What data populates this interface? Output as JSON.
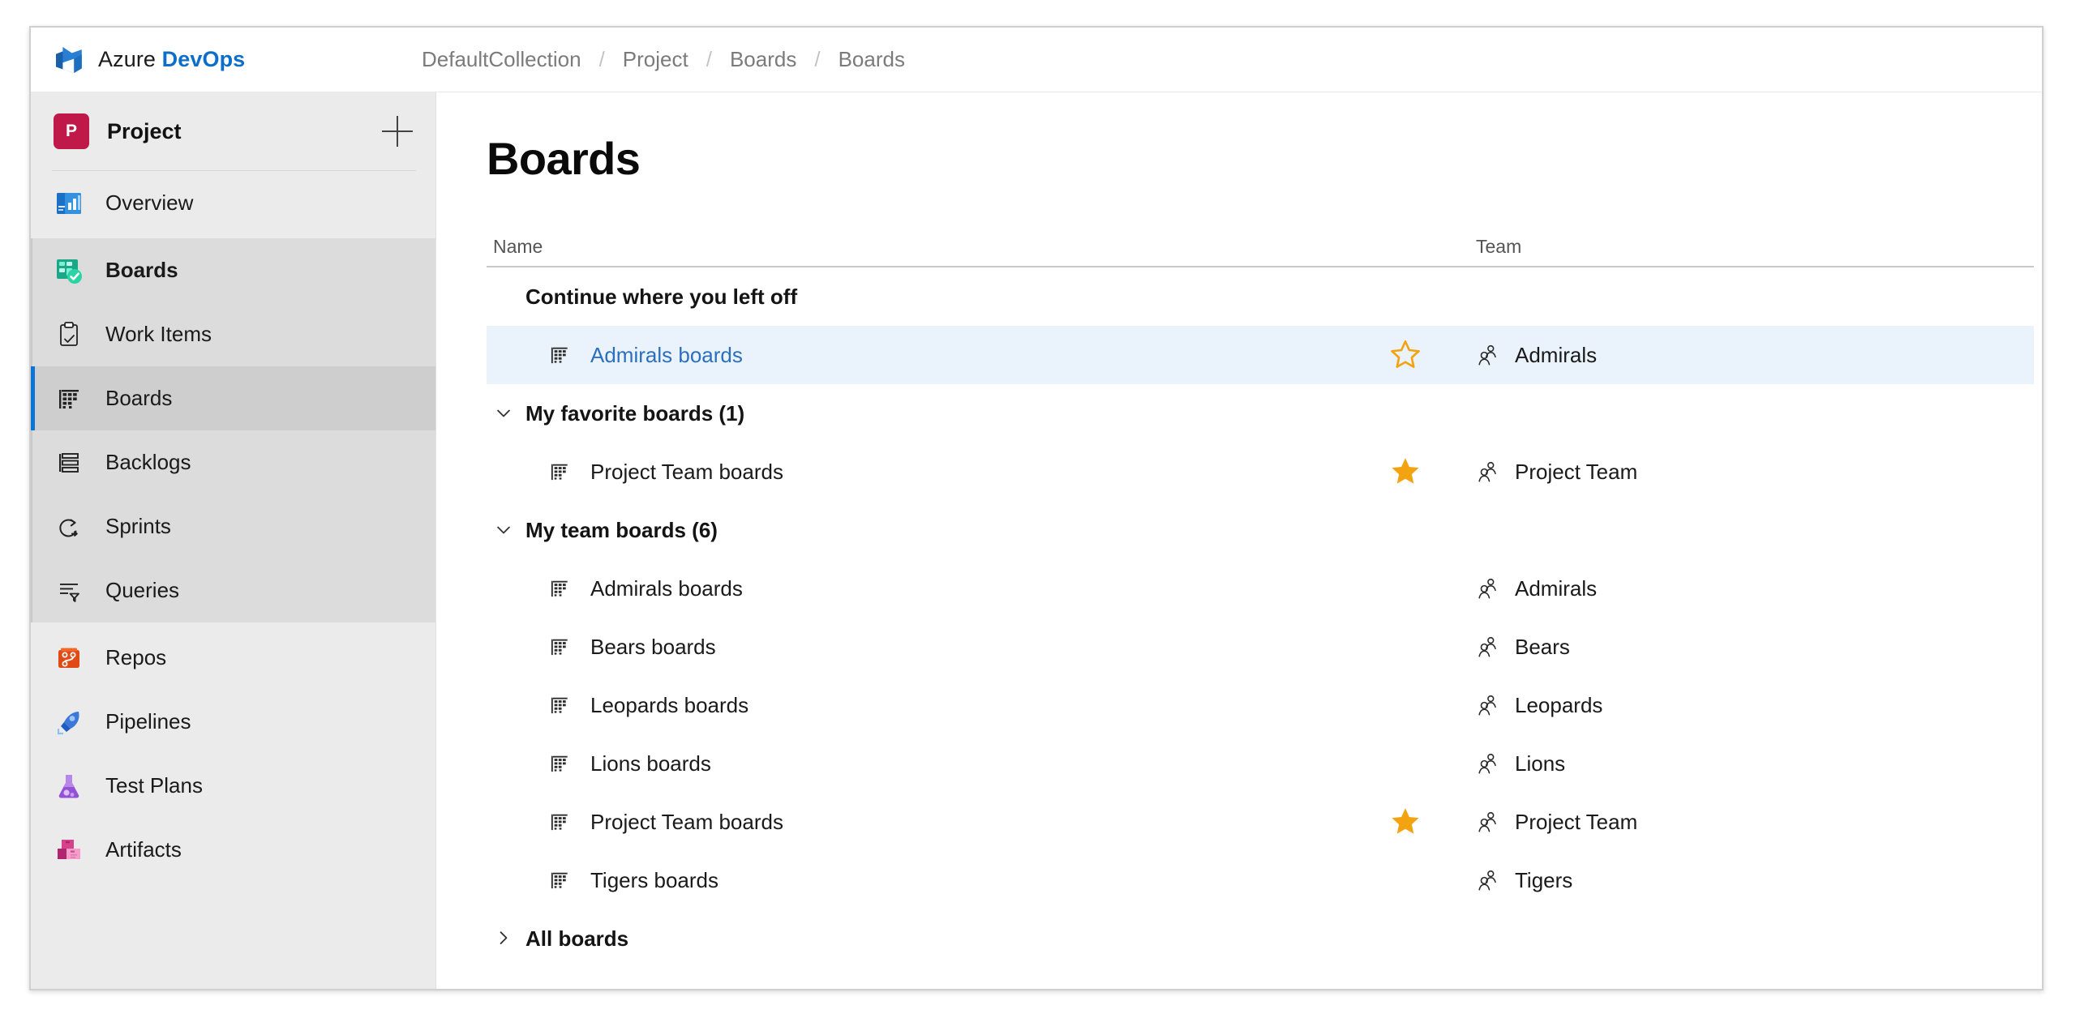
{
  "topbar": {
    "logo_icon": "azure-devops-logo",
    "brand_prefix": "Azure ",
    "brand_suffix": "DevOps",
    "breadcrumb": [
      "DefaultCollection",
      "Project",
      "Boards",
      "Boards"
    ],
    "breadcrumb_separator": "/"
  },
  "sidebar": {
    "project": {
      "avatar_letter": "P",
      "name": "Project",
      "avatar_color": "#bf1849",
      "add_icon": "plus-icon"
    },
    "top_items": [
      {
        "label": "Overview",
        "icon": "overview-icon"
      }
    ],
    "boards_group": [
      {
        "label": "Boards",
        "icon": "boards-product-icon",
        "bold": true,
        "selected": false
      },
      {
        "label": "Work Items",
        "icon": "work-items-icon",
        "bold": false,
        "selected": false
      },
      {
        "label": "Boards",
        "icon": "board-grid-icon",
        "bold": false,
        "selected": true
      },
      {
        "label": "Backlogs",
        "icon": "backlogs-icon",
        "bold": false,
        "selected": false
      },
      {
        "label": "Sprints",
        "icon": "sprints-icon",
        "bold": false,
        "selected": false
      },
      {
        "label": "Queries",
        "icon": "queries-icon",
        "bold": false,
        "selected": false
      }
    ],
    "tail_items": [
      {
        "label": "Repos",
        "icon": "repos-icon"
      },
      {
        "label": "Pipelines",
        "icon": "pipelines-icon"
      },
      {
        "label": "Test Plans",
        "icon": "test-plans-icon"
      },
      {
        "label": "Artifacts",
        "icon": "artifacts-icon"
      }
    ]
  },
  "main": {
    "title": "Boards",
    "columns": {
      "name": "Name",
      "team": "Team"
    },
    "sections": [
      {
        "title": "Continue where you left off",
        "expander": "none",
        "rows": [
          {
            "name": "Admirals boards",
            "team": "Admirals",
            "star": "outline",
            "highlight": true,
            "link": true,
            "board_icon": "board-grid-icon",
            "team_icon": "team-group-icon"
          }
        ]
      },
      {
        "title": "My favorite boards (1)",
        "expander": "chevron-down-icon",
        "rows": [
          {
            "name": "Project Team boards",
            "team": "Project Team",
            "star": "filled",
            "highlight": false,
            "link": false,
            "board_icon": "board-grid-icon",
            "team_icon": "team-group-icon"
          }
        ]
      },
      {
        "title": "My team boards (6)",
        "expander": "chevron-down-icon",
        "rows": [
          {
            "name": "Admirals boards",
            "team": "Admirals",
            "star": "none",
            "highlight": false,
            "link": false,
            "board_icon": "board-grid-icon",
            "team_icon": "team-group-icon"
          },
          {
            "name": "Bears boards",
            "team": "Bears",
            "star": "none",
            "highlight": false,
            "link": false,
            "board_icon": "board-grid-icon",
            "team_icon": "team-group-icon"
          },
          {
            "name": "Leopards boards",
            "team": "Leopards",
            "star": "none",
            "highlight": false,
            "link": false,
            "board_icon": "board-grid-icon",
            "team_icon": "team-group-icon"
          },
          {
            "name": "Lions boards",
            "team": "Lions",
            "star": "none",
            "highlight": false,
            "link": false,
            "board_icon": "board-grid-icon",
            "team_icon": "team-group-icon"
          },
          {
            "name": "Project Team boards",
            "team": "Project Team",
            "star": "filled",
            "highlight": false,
            "link": false,
            "board_icon": "board-grid-icon",
            "team_icon": "team-group-icon"
          },
          {
            "name": "Tigers boards",
            "team": "Tigers",
            "star": "none",
            "highlight": false,
            "link": false,
            "board_icon": "board-grid-icon",
            "team_icon": "team-group-icon"
          }
        ]
      },
      {
        "title": "All boards",
        "expander": "chevron-right-icon",
        "rows": []
      }
    ]
  },
  "colors": {
    "accent_blue": "#0b74d4",
    "link_blue": "#2b6fbd",
    "star_gold": "#f2a30f",
    "project_crimson": "#bf1849",
    "row_highlight": "#eaf3fb"
  }
}
